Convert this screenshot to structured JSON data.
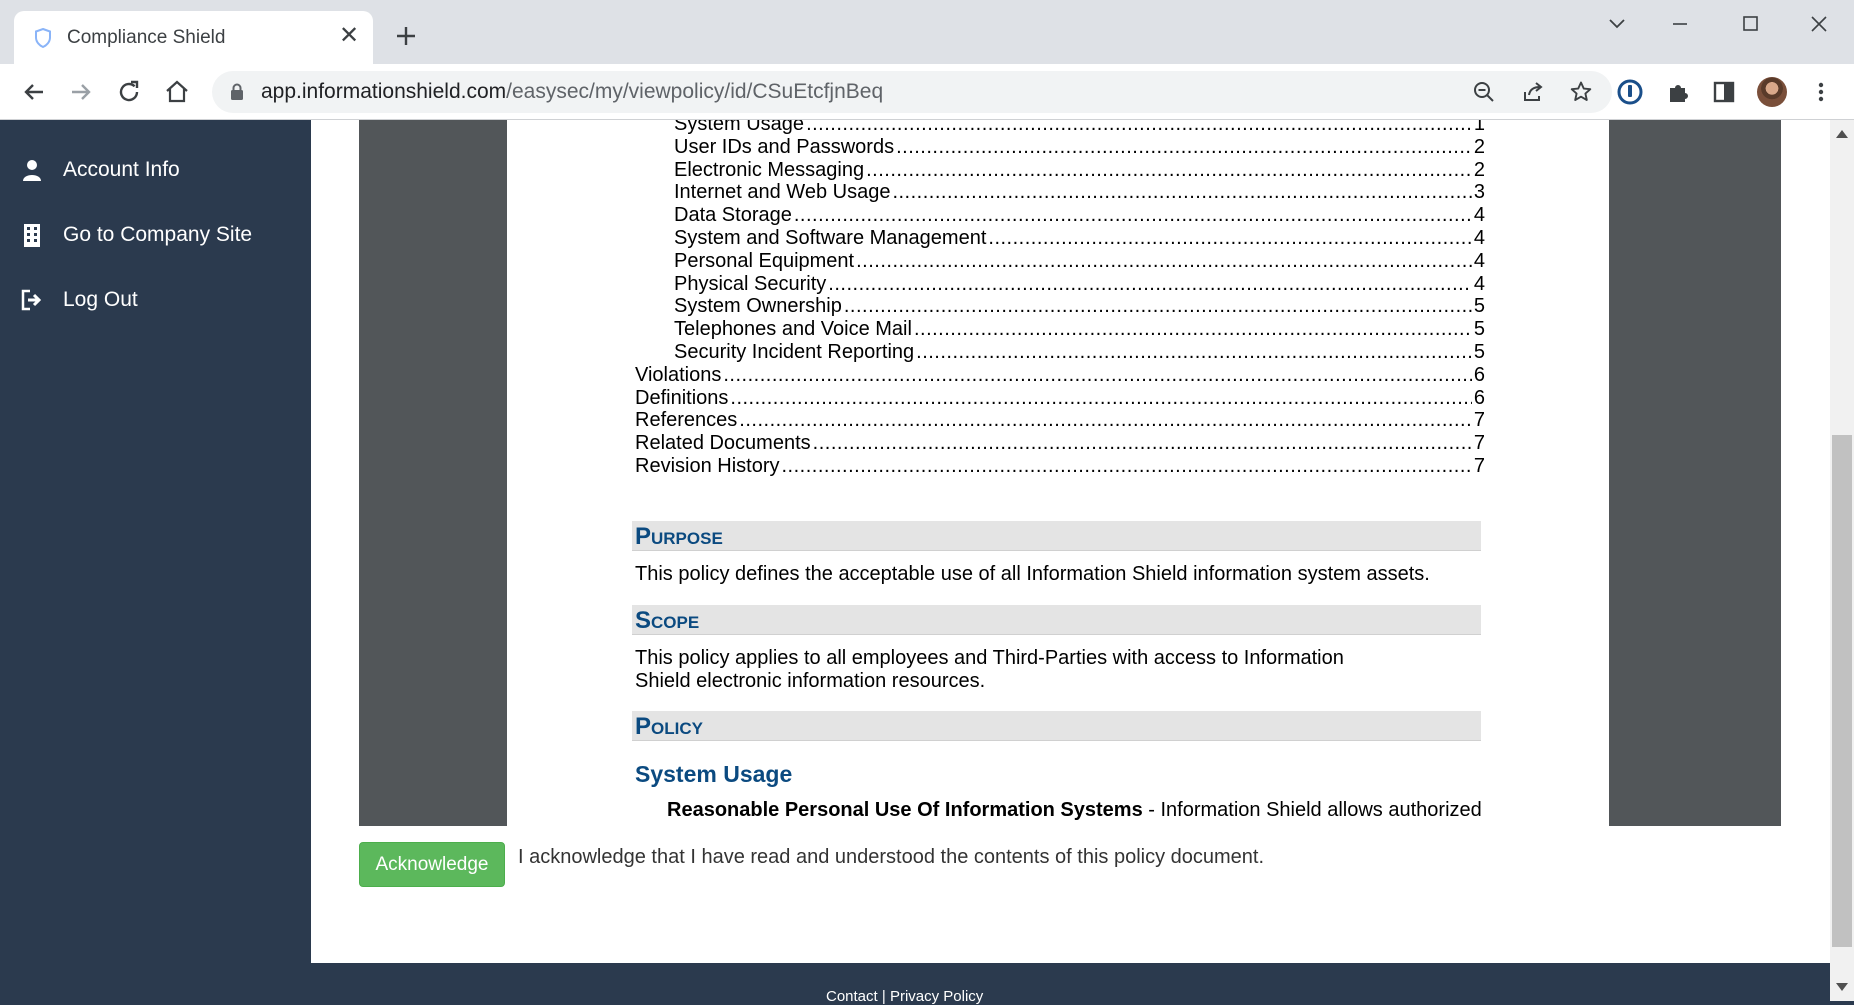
{
  "browser": {
    "tab_title": "Compliance Shield",
    "url_host": "app.informationshield.com",
    "url_path": "/easysec/my/viewpolicy/id/CSuEtcfjnBeq"
  },
  "sidebar": {
    "items": [
      {
        "label": "Account Info",
        "icon": "user-icon"
      },
      {
        "label": "Go to Company Site",
        "icon": "building-icon"
      },
      {
        "label": "Log Out",
        "icon": "logout-icon"
      }
    ]
  },
  "document": {
    "toc": [
      {
        "title": "System Usage",
        "page": "1",
        "level": 2
      },
      {
        "title": "User IDs and Passwords",
        "page": "2",
        "level": 2
      },
      {
        "title": "Electronic Messaging",
        "page": "2",
        "level": 2
      },
      {
        "title": "Internet and Web Usage",
        "page": "3",
        "level": 2
      },
      {
        "title": "Data Storage",
        "page": "4",
        "level": 2
      },
      {
        "title": "System and Software Management",
        "page": "4",
        "level": 2
      },
      {
        "title": "Personal Equipment",
        "page": "4",
        "level": 2
      },
      {
        "title": "Physical Security",
        "page": "4",
        "level": 2
      },
      {
        "title": "System Ownership",
        "page": "5",
        "level": 2
      },
      {
        "title": "Telephones and Voice Mail",
        "page": "5",
        "level": 2
      },
      {
        "title": "Security Incident Reporting",
        "page": "5",
        "level": 2
      },
      {
        "title": "Violations",
        "page": "6",
        "level": 1
      },
      {
        "title": "Definitions",
        "page": "6",
        "level": 1
      },
      {
        "title": "References",
        "page": "7",
        "level": 1
      },
      {
        "title": "Related Documents",
        "page": "7",
        "level": 1
      },
      {
        "title": "Revision History",
        "page": "7",
        "level": 1
      }
    ],
    "purpose_heading": "Purpose",
    "purpose_text": "This policy defines the acceptable use of all Information Shield information system assets.",
    "scope_heading": "Scope",
    "scope_text": "This policy applies to all employees and Third-Parties with access to Information Shield electronic information resources.",
    "policy_heading": "Policy",
    "system_usage_heading": "System Usage",
    "rule_title": "Reasonable Personal Use Of Information Systems",
    "rule_text": " - Information Shield allows authorized"
  },
  "actions": {
    "acknowledge_label": "Acknowledge",
    "acknowledge_text": "I acknowledge that I have read and understood the contents of this policy document."
  },
  "footer": {
    "contact": "Contact",
    "separator": "|",
    "privacy": "Privacy Policy"
  },
  "colors": {
    "sidebar_bg": "#2b3a4e",
    "heading_blue": "#0b4a80",
    "button_green": "#5cb85c",
    "viewer_bg": "#525659"
  }
}
